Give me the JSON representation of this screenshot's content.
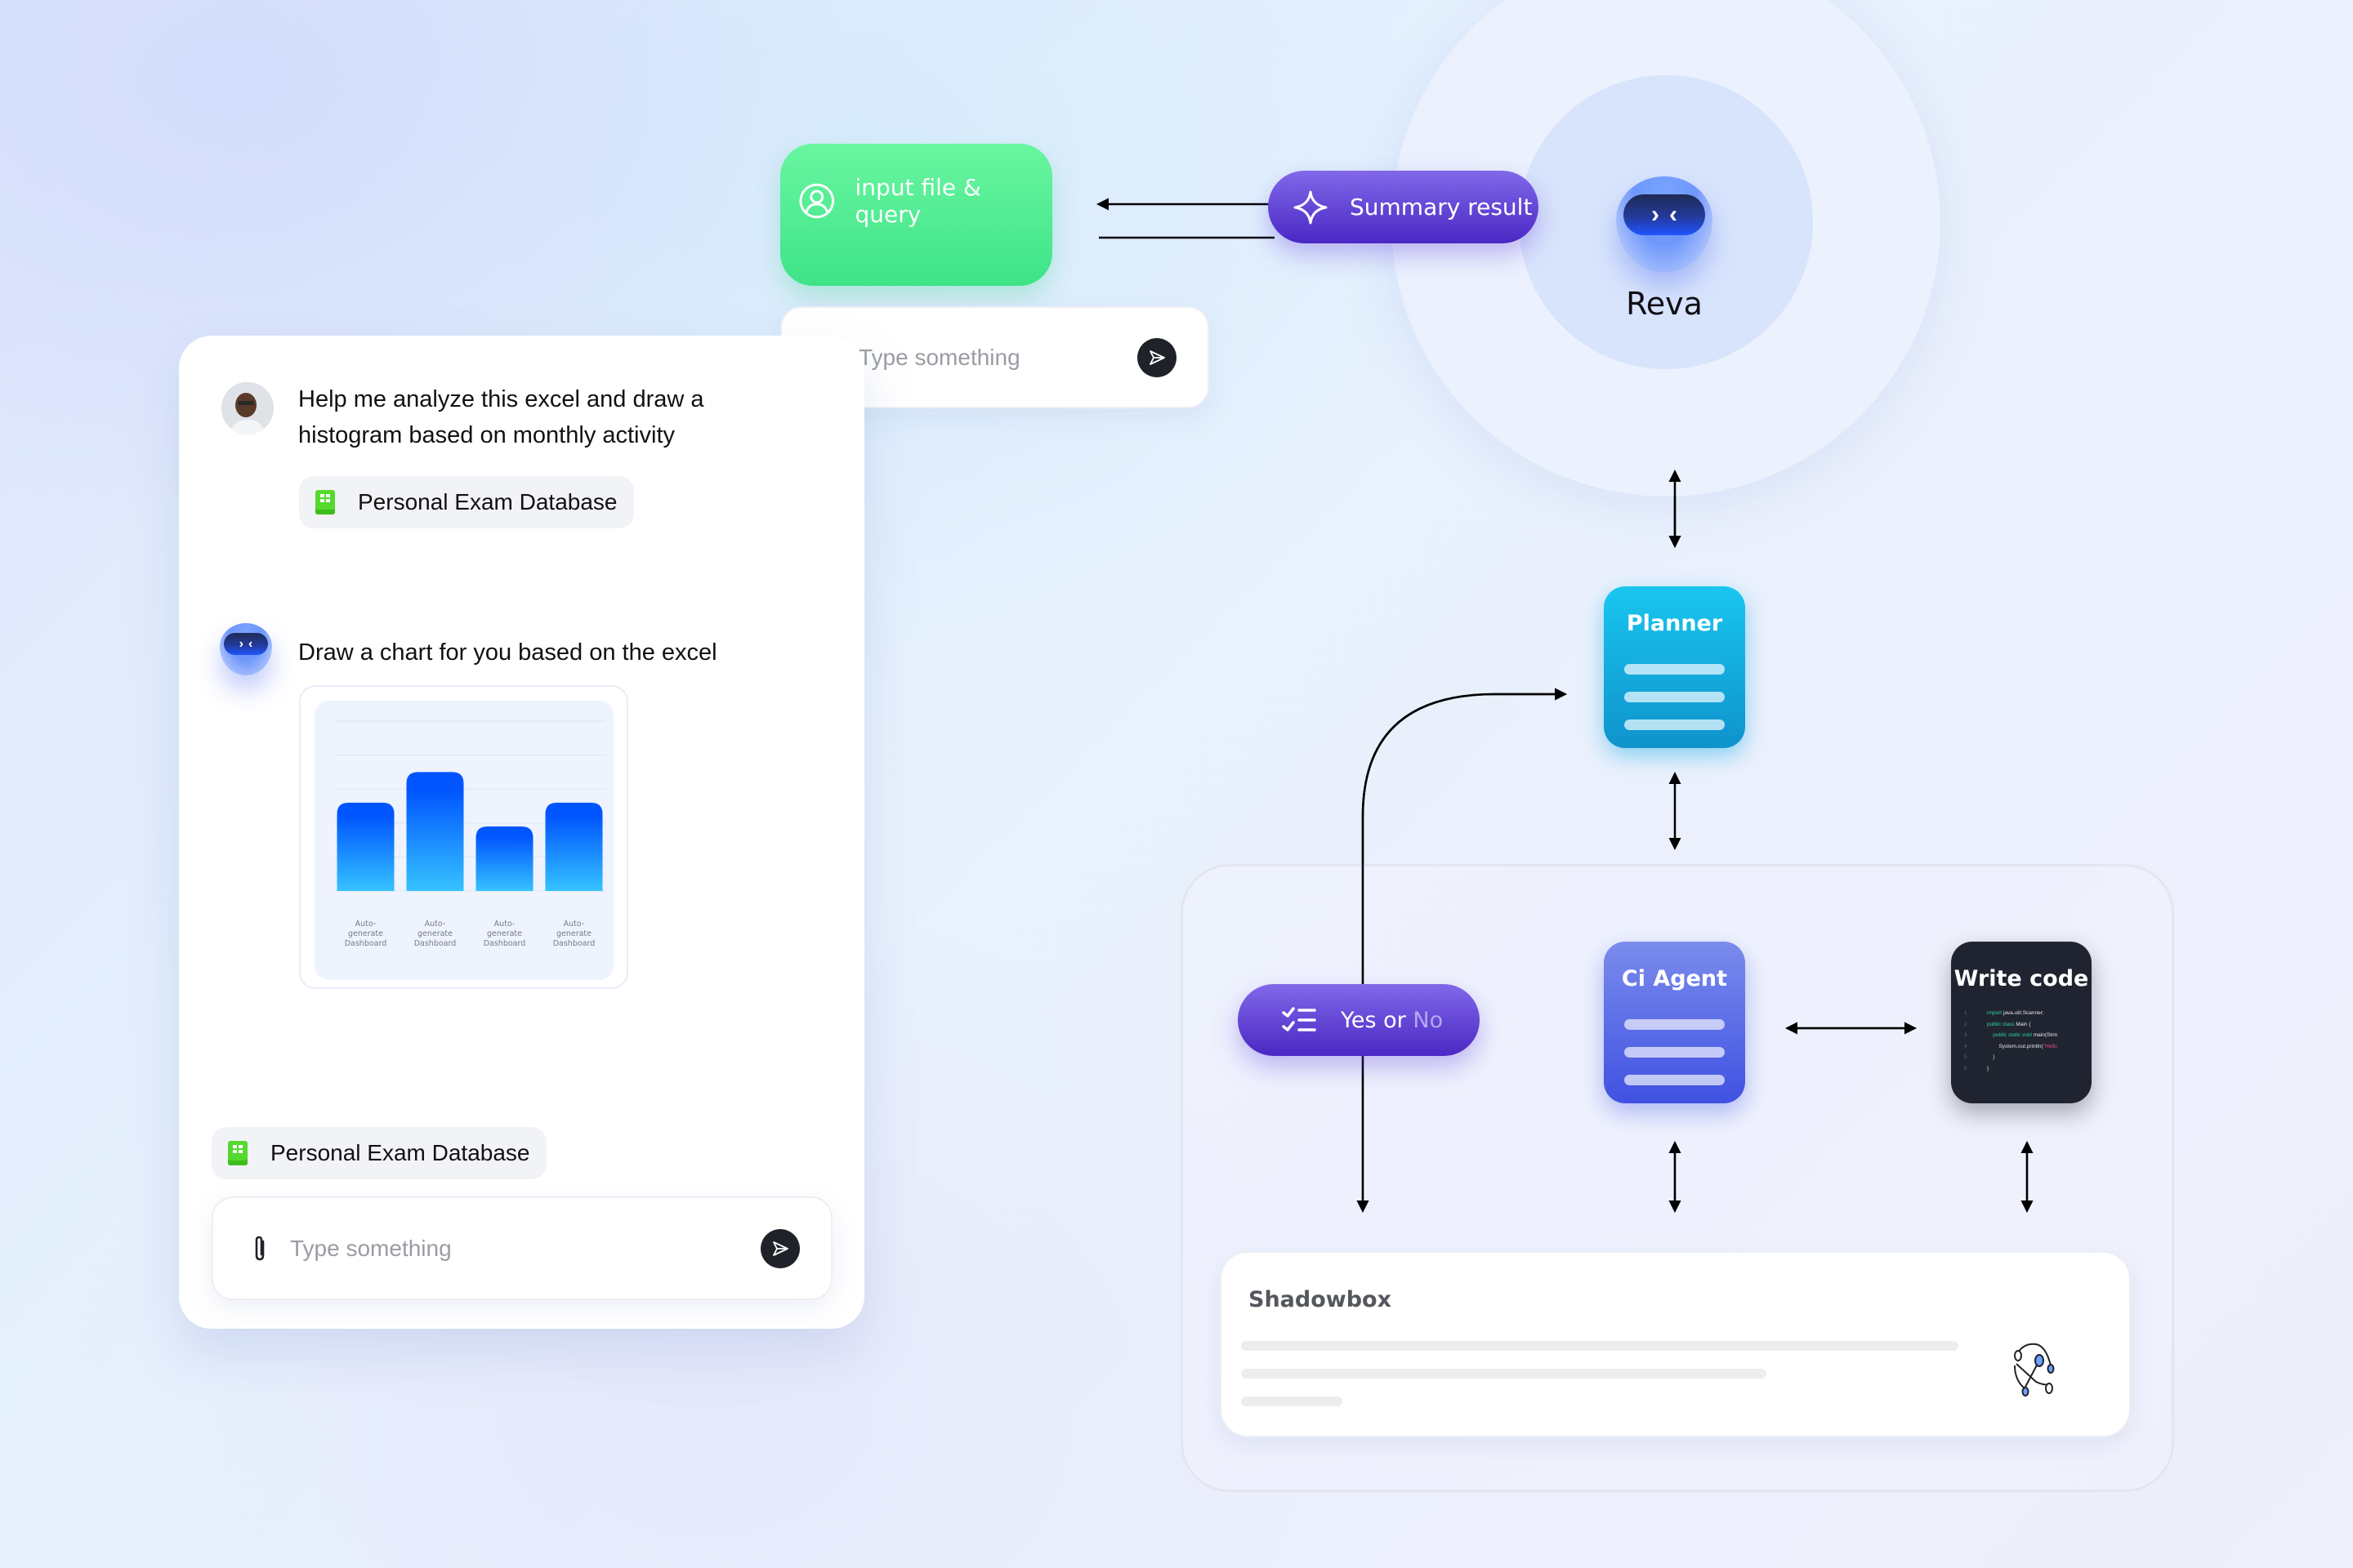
{
  "nodes": {
    "input_node": {
      "label": "input file & query",
      "icon": "user-circle-icon",
      "color": "#4deb92"
    },
    "top_input": {
      "placeholder": "Type something",
      "attach_icon": "paperclip-icon",
      "send_icon": "send-icon"
    },
    "summary": {
      "label": "Summary result",
      "icon": "sparkle-icon",
      "color": "#6446d8"
    },
    "reva": {
      "label": "Reva",
      "icon": "bot-icon"
    },
    "planner": {
      "label": "Planner",
      "color": "#16b4e4"
    },
    "ci_agent": {
      "label": "Ci Agent",
      "color": "#5a6ae8"
    },
    "write_code": {
      "label": "Write code",
      "code_lines": [
        {
          "n": "1",
          "parts": [
            {
              "t": "import ",
              "c": "kw"
            },
            {
              "t": "java.util.Scanner;",
              "c": ""
            }
          ]
        },
        {
          "n": "2",
          "parts": [
            {
              "t": "public class ",
              "c": "kw"
            },
            {
              "t": "Main {",
              "c": ""
            }
          ]
        },
        {
          "n": "3",
          "parts": [
            {
              "t": "    public static void ",
              "c": "kw"
            },
            {
              "t": "main(Strin",
              "c": ""
            }
          ]
        },
        {
          "n": "4",
          "parts": [
            {
              "t": "        System.out.println(",
              "c": ""
            },
            {
              "t": "\"Hello",
              "c": "str"
            }
          ]
        },
        {
          "n": "5",
          "parts": [
            {
              "t": "    }",
              "c": ""
            }
          ]
        },
        {
          "n": "6",
          "parts": [
            {
              "t": "}",
              "c": ""
            }
          ]
        }
      ]
    },
    "yes_no": {
      "label_main": "Yes or ",
      "label_dim": "No",
      "icon": "checklist-icon"
    },
    "shadowbox": {
      "label": "Shadowbox",
      "icon": "network-nodes-icon"
    }
  },
  "chat": {
    "user_message": "Help me analyze this excel and draw a histogram based on monthly activity",
    "user_attachment": "Personal Exam Database",
    "bot_message": "Draw a chart for you based on the excel",
    "pending_attachment": "Personal Exam Database",
    "input_placeholder": "Type something"
  },
  "chart_data": {
    "type": "bar",
    "title": "",
    "xlabel": "",
    "ylabel": "",
    "categories": [
      "Auto-generate Dashboard",
      "Auto-generate Dashboard",
      "Auto-generate Dashboard",
      "Auto-generate Dashboard"
    ],
    "values": [
      2.6,
      3.5,
      1.9,
      2.6
    ],
    "ylim": [
      0,
      5
    ],
    "grid": true,
    "legend": "none",
    "colors": {
      "top": "#0055ff",
      "bottom": "#36c2ff"
    }
  }
}
